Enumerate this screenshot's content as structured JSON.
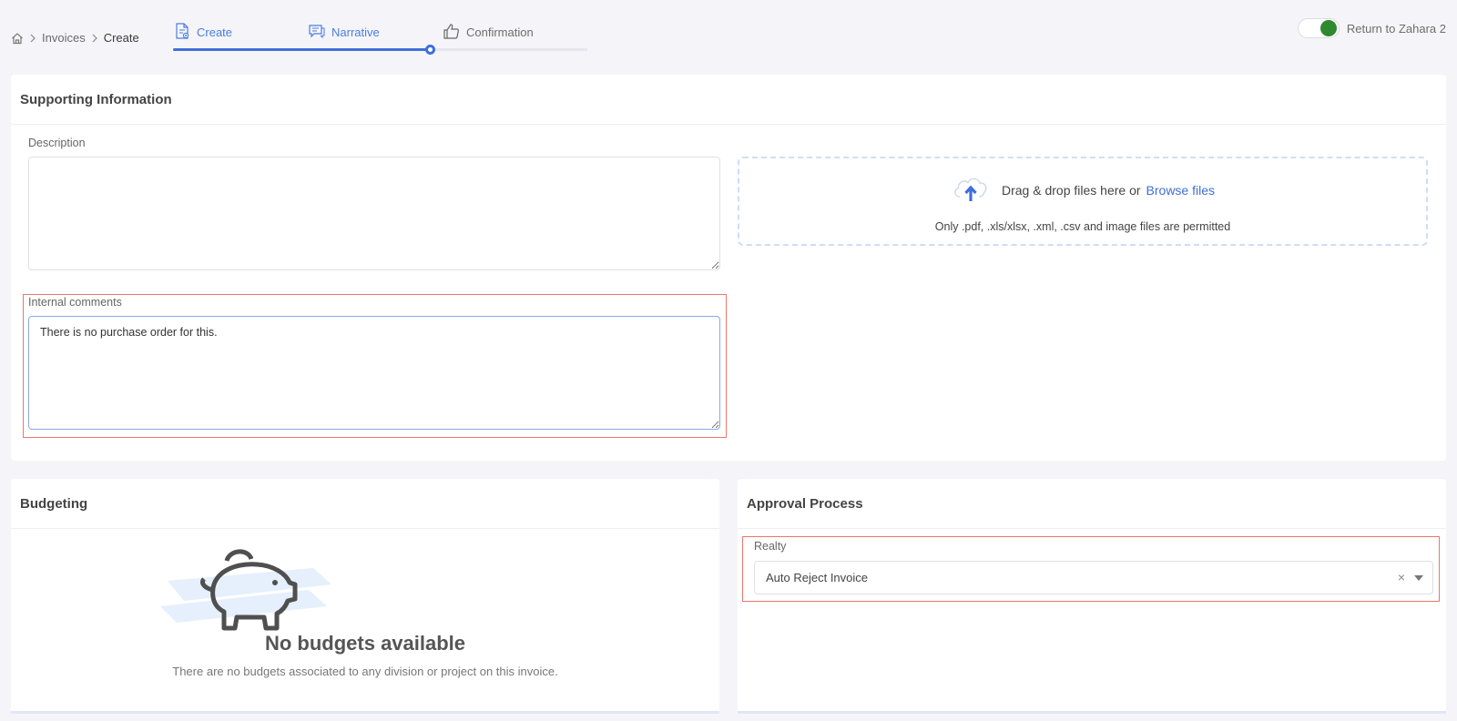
{
  "breadcrumb": {
    "items": [
      "Invoices",
      "Create"
    ]
  },
  "steps": [
    {
      "label": "Create",
      "state": "active"
    },
    {
      "label": "Narrative",
      "state": "active"
    },
    {
      "label": "Confirmation",
      "state": "idle"
    }
  ],
  "progress": {
    "fraction": 0.62
  },
  "toggle": {
    "label": "Return to Zahara 2",
    "on": true
  },
  "supporting": {
    "title": "Supporting Information",
    "description": {
      "label": "Description",
      "value": ""
    },
    "internal_comments": {
      "label": "Internal comments",
      "value": "There is no purchase order for this. "
    },
    "dropzone": {
      "text": "Drag & drop files here or",
      "link": "Browse files",
      "note": "Only .pdf, .xls/xlsx, .xml, .csv and image files are permitted"
    }
  },
  "budgeting": {
    "title": "Budgeting",
    "empty_title": "No budgets available",
    "empty_text": "There are no budgets associated to any division or project on this invoice."
  },
  "approval": {
    "title": "Approval Process",
    "field_label": "Realty",
    "selected": "Auto Reject Invoice",
    "clear": "×"
  },
  "colors": {
    "accent": "#3f6fd8",
    "highlight": "#e8776e",
    "toggle_on": "#2f8a2f"
  }
}
